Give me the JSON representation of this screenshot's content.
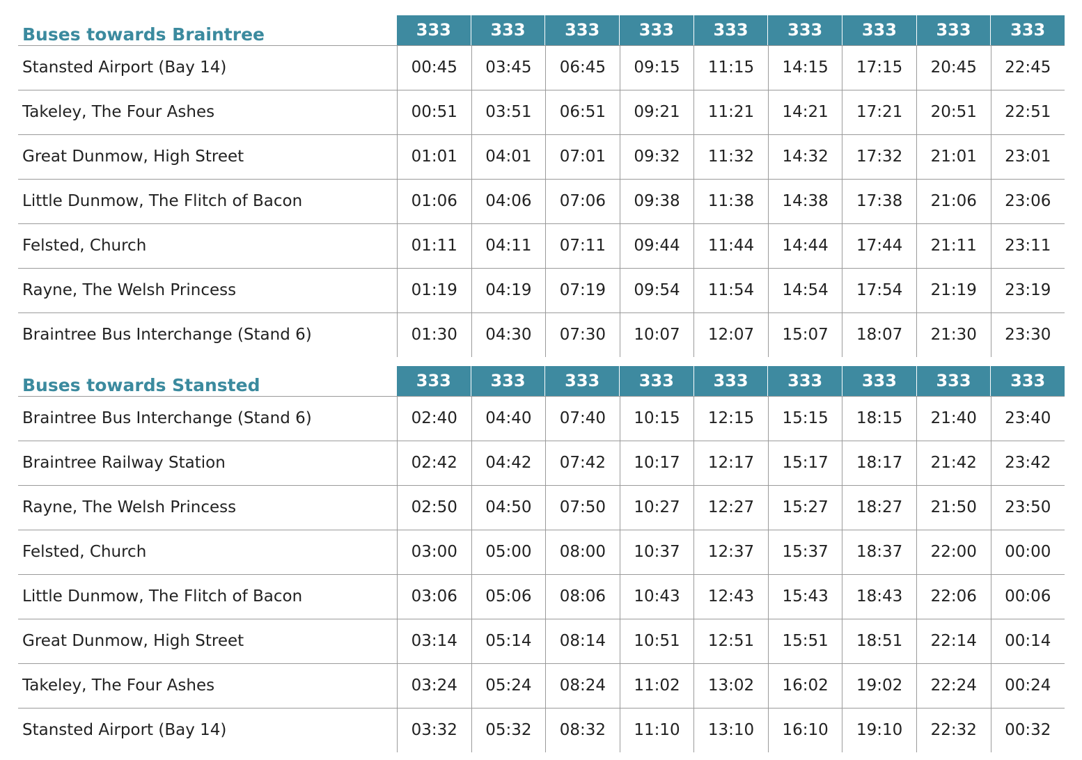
{
  "colors": {
    "accent": "#3e8aa0",
    "title": "#3b8a9e",
    "rule": "#9a9a9a"
  },
  "sections": [
    {
      "title": "Buses towards Braintree",
      "routes": [
        "333",
        "333",
        "333",
        "333",
        "333",
        "333",
        "333",
        "333",
        "333"
      ],
      "rows": [
        {
          "stop": "Stansted Airport (Bay 14)",
          "times": [
            "00:45",
            "03:45",
            "06:45",
            "09:15",
            "11:15",
            "14:15",
            "17:15",
            "20:45",
            "22:45"
          ]
        },
        {
          "stop": "Takeley, The Four Ashes",
          "times": [
            "00:51",
            "03:51",
            "06:51",
            "09:21",
            "11:21",
            "14:21",
            "17:21",
            "20:51",
            "22:51"
          ]
        },
        {
          "stop": "Great Dunmow, High Street",
          "times": [
            "01:01",
            "04:01",
            "07:01",
            "09:32",
            "11:32",
            "14:32",
            "17:32",
            "21:01",
            "23:01"
          ]
        },
        {
          "stop": "Little Dunmow, The Flitch of Bacon",
          "times": [
            "01:06",
            "04:06",
            "07:06",
            "09:38",
            "11:38",
            "14:38",
            "17:38",
            "21:06",
            "23:06"
          ]
        },
        {
          "stop": "Felsted, Church",
          "times": [
            "01:11",
            "04:11",
            "07:11",
            "09:44",
            "11:44",
            "14:44",
            "17:44",
            "21:11",
            "23:11"
          ]
        },
        {
          "stop": "Rayne, The Welsh Princess",
          "times": [
            "01:19",
            "04:19",
            "07:19",
            "09:54",
            "11:54",
            "14:54",
            "17:54",
            "21:19",
            "23:19"
          ]
        },
        {
          "stop": "Braintree Bus Interchange (Stand 6)",
          "times": [
            "01:30",
            "04:30",
            "07:30",
            "10:07",
            "12:07",
            "15:07",
            "18:07",
            "21:30",
            "23:30"
          ]
        }
      ]
    },
    {
      "title": "Buses towards Stansted",
      "routes": [
        "333",
        "333",
        "333",
        "333",
        "333",
        "333",
        "333",
        "333",
        "333"
      ],
      "rows": [
        {
          "stop": "Braintree Bus Interchange (Stand 6)",
          "times": [
            "02:40",
            "04:40",
            "07:40",
            "10:15",
            "12:15",
            "15:15",
            "18:15",
            "21:40",
            "23:40"
          ]
        },
        {
          "stop": "Braintree Railway Station",
          "times": [
            "02:42",
            "04:42",
            "07:42",
            "10:17",
            "12:17",
            "15:17",
            "18:17",
            "21:42",
            "23:42"
          ]
        },
        {
          "stop": "Rayne, The Welsh Princess",
          "times": [
            "02:50",
            "04:50",
            "07:50",
            "10:27",
            "12:27",
            "15:27",
            "18:27",
            "21:50",
            "23:50"
          ]
        },
        {
          "stop": "Felsted, Church",
          "times": [
            "03:00",
            "05:00",
            "08:00",
            "10:37",
            "12:37",
            "15:37",
            "18:37",
            "22:00",
            "00:00"
          ]
        },
        {
          "stop": "Little Dunmow, The Flitch of Bacon",
          "times": [
            "03:06",
            "05:06",
            "08:06",
            "10:43",
            "12:43",
            "15:43",
            "18:43",
            "22:06",
            "00:06"
          ]
        },
        {
          "stop": "Great Dunmow, High Street",
          "times": [
            "03:14",
            "05:14",
            "08:14",
            "10:51",
            "12:51",
            "15:51",
            "18:51",
            "22:14",
            "00:14"
          ]
        },
        {
          "stop": "Takeley, The Four Ashes",
          "times": [
            "03:24",
            "05:24",
            "08:24",
            "11:02",
            "13:02",
            "16:02",
            "19:02",
            "22:24",
            "00:24"
          ]
        },
        {
          "stop": "Stansted Airport (Bay 14)",
          "times": [
            "03:32",
            "05:32",
            "08:32",
            "11:10",
            "13:10",
            "16:10",
            "19:10",
            "22:32",
            "00:32"
          ]
        }
      ]
    }
  ]
}
